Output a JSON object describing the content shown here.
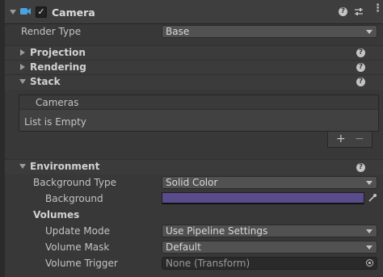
{
  "component": {
    "title": "Camera",
    "enabled": true
  },
  "render_type": {
    "label": "Render Type",
    "value": "Base"
  },
  "sections": {
    "projection": "Projection",
    "rendering": "Rendering",
    "stack": "Stack",
    "environment": "Environment"
  },
  "stack": {
    "list_header": "Cameras",
    "empty_text": "List is Empty",
    "add_symbol": "+",
    "remove_symbol": "−"
  },
  "environment": {
    "background_type": {
      "label": "Background Type",
      "value": "Solid Color"
    },
    "background": {
      "label": "Background",
      "color": "#5a4c8c"
    },
    "volumes_label": "Volumes",
    "update_mode": {
      "label": "Update Mode",
      "value": "Use Pipeline Settings"
    },
    "volume_mask": {
      "label": "Volume Mask",
      "value": "Default"
    },
    "volume_trigger": {
      "label": "Volume Trigger",
      "value": "None (Transform)"
    }
  },
  "icons": {
    "camera": "camera-icon",
    "help": "help-icon",
    "presets": "presets-icon",
    "menu": "kebab-menu-icon",
    "eyedropper": "eyedropper-icon",
    "object_picker": "object-picker-icon"
  }
}
